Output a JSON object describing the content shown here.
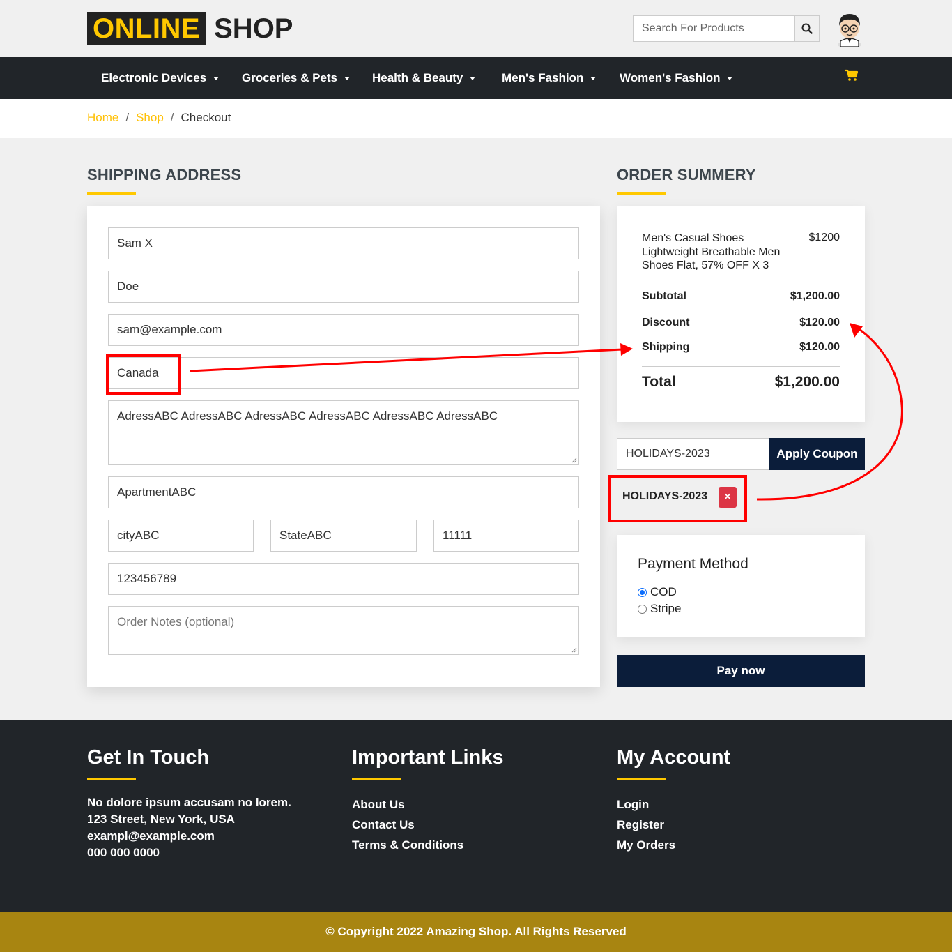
{
  "header": {
    "logo_highlight": "ONLINE",
    "logo_rest": "SHOP",
    "search_placeholder": "Search For Products"
  },
  "nav": {
    "items": [
      {
        "label": "Electronic Devices"
      },
      {
        "label": "Groceries & Pets"
      },
      {
        "label": "Health & Beauty"
      },
      {
        "label": "Men's Fashion"
      },
      {
        "label": "Women's Fashion"
      }
    ]
  },
  "breadcrumb": {
    "home": "Home",
    "shop": "Shop",
    "current": "Checkout",
    "separator": "/"
  },
  "shipping": {
    "title": "SHIPPING ADDRESS",
    "first_name": "Sam X",
    "last_name": "Doe",
    "email": "sam@example.com",
    "country": "Canada",
    "address": "AdressABC AdressABC AdressABC AdressABC AdressABC AdressABC",
    "apartment": "ApartmentABC",
    "city": "cityABC",
    "state": "StateABC",
    "zip": "11111",
    "phone": "123456789",
    "notes_placeholder": "Order Notes (optional)"
  },
  "summary": {
    "title": "ORDER SUMMERY",
    "item_name": "Men's Casual Shoes Lightweight Breathable Men Shoes Flat, 57% OFF X 3",
    "item_price": "$1200",
    "subtotal_label": "Subtotal",
    "subtotal_value": "$1,200.00",
    "discount_label": "Discount",
    "discount_value": "$120.00",
    "shipping_label": "Shipping",
    "shipping_value": "$120.00",
    "total_label": "Total",
    "total_value": "$1,200.00"
  },
  "coupon": {
    "input_value": "HOLIDAYS-2023",
    "button_label": "Apply Coupon",
    "applied_code": "HOLIDAYS-2023",
    "remove_symbol": "×"
  },
  "payment": {
    "title": "Payment Method",
    "options": [
      {
        "label": "COD",
        "selected": true
      },
      {
        "label": "Stripe",
        "selected": false
      }
    ],
    "pay_button": "Pay now"
  },
  "footer": {
    "contact": {
      "title": "Get In Touch",
      "lines": [
        "No dolore ipsum accusam no lorem.",
        "123 Street, New York, USA",
        "exampl@example.com",
        "000 000 0000"
      ]
    },
    "links": {
      "title": "Important Links",
      "items": [
        "About Us",
        "Contact Us",
        "Terms & Conditions"
      ]
    },
    "account": {
      "title": "My Account",
      "items": [
        "Login",
        "Register",
        "My Orders"
      ]
    },
    "copyright": "© Copyright 2022 Amazing Shop. All Rights Reserved"
  },
  "colors": {
    "accent": "#ffc800",
    "nav_bg": "#212529",
    "button_bg": "#0b1d3a",
    "annotation": "#ff0000",
    "copyright_bg": "#a88511"
  }
}
